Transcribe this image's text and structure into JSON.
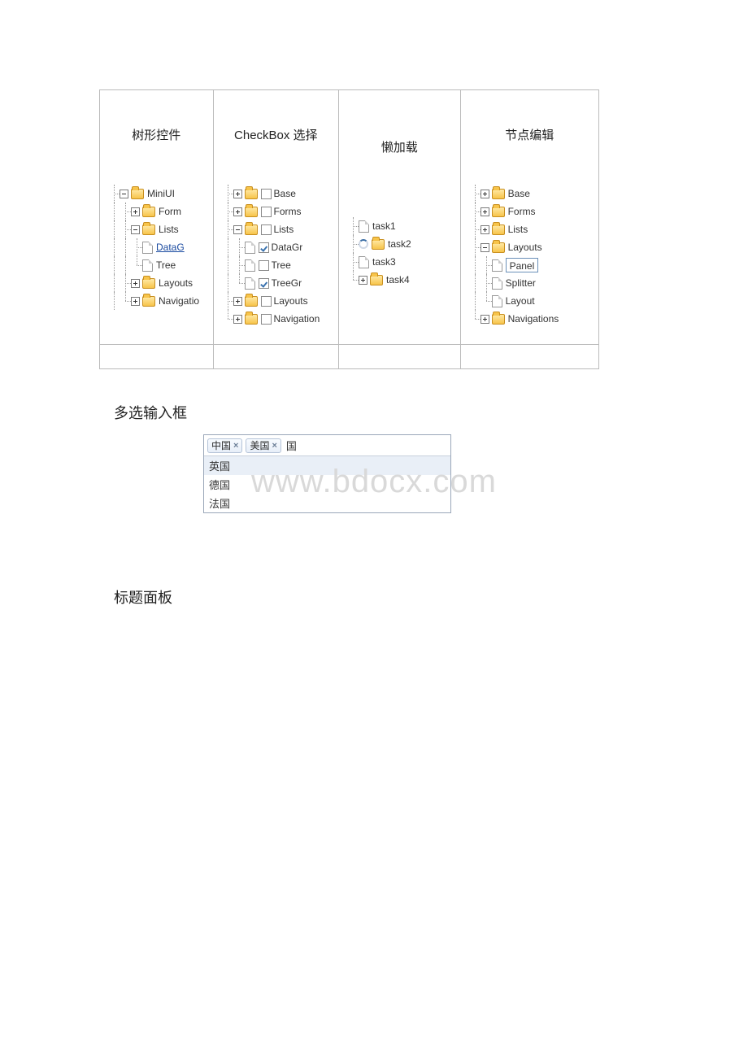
{
  "watermark": "www.bdocx.com",
  "columns": [
    {
      "title": "树形控件",
      "tree": [
        {
          "depth": 0,
          "toggle": "minus",
          "icon": "folder",
          "label": "MiniUI"
        },
        {
          "depth": 1,
          "toggle": "plus",
          "icon": "folder",
          "label": "Form"
        },
        {
          "depth": 1,
          "toggle": "minus",
          "icon": "folder",
          "label": "Lists"
        },
        {
          "depth": 2,
          "toggle": null,
          "icon": "file",
          "label": "DataG",
          "link": true
        },
        {
          "depth": 2,
          "toggle": null,
          "icon": "file",
          "label": "Tree",
          "last": true
        },
        {
          "depth": 1,
          "toggle": "plus",
          "icon": "folder",
          "label": "Layouts"
        },
        {
          "depth": 1,
          "toggle": "plus",
          "icon": "folder",
          "label": "Navigatio",
          "last": true
        }
      ]
    },
    {
      "title": "CheckBox 选择",
      "tree": [
        {
          "depth": 0,
          "toggle": "plus",
          "icon": "folder",
          "cb": "unchecked",
          "label": "Base"
        },
        {
          "depth": 0,
          "toggle": "plus",
          "icon": "folder",
          "cb": "unchecked",
          "label": "Forms"
        },
        {
          "depth": 0,
          "toggle": "minus",
          "icon": "folder",
          "cb": "unchecked",
          "label": "Lists"
        },
        {
          "depth": 1,
          "toggle": null,
          "icon": "file",
          "cb": "checked",
          "label": "DataGr"
        },
        {
          "depth": 1,
          "toggle": null,
          "icon": "file",
          "cb": "unchecked",
          "label": "Tree"
        },
        {
          "depth": 1,
          "toggle": null,
          "icon": "file",
          "cb": "checked",
          "label": "TreeGr",
          "last": true
        },
        {
          "depth": 0,
          "toggle": "plus",
          "icon": "folder",
          "cb": "unchecked",
          "label": "Layouts"
        },
        {
          "depth": 0,
          "toggle": "plus",
          "icon": "folder",
          "cb": "unchecked",
          "label": "Navigation",
          "last": true
        }
      ]
    },
    {
      "title": "懒加载",
      "tree": [
        {
          "depth": 0,
          "toggle": null,
          "icon": "file",
          "label": "task1"
        },
        {
          "depth": 0,
          "toggle": "spinner",
          "icon": "folder",
          "label": "task2"
        },
        {
          "depth": 0,
          "toggle": null,
          "icon": "file",
          "label": "task3"
        },
        {
          "depth": 0,
          "toggle": "plus",
          "icon": "folder",
          "label": "task4",
          "last": true
        }
      ]
    },
    {
      "title": "节点编辑",
      "tree": [
        {
          "depth": 0,
          "toggle": "plus",
          "icon": "folder",
          "label": "Base"
        },
        {
          "depth": 0,
          "toggle": "plus",
          "icon": "folder",
          "label": "Forms"
        },
        {
          "depth": 0,
          "toggle": "plus",
          "icon": "folder",
          "label": "Lists"
        },
        {
          "depth": 0,
          "toggle": "minus",
          "icon": "folder",
          "label": "Layouts"
        },
        {
          "depth": 1,
          "toggle": null,
          "icon": "file",
          "label": "Panel",
          "editing": true
        },
        {
          "depth": 1,
          "toggle": null,
          "icon": "file",
          "label": "Splitter"
        },
        {
          "depth": 1,
          "toggle": null,
          "icon": "file",
          "label": "Layout",
          "last": true
        },
        {
          "depth": 0,
          "toggle": "plus",
          "icon": "folder",
          "label": "Navigations",
          "last": true
        }
      ]
    }
  ],
  "multiselect_title": "多选输入框",
  "multiselect": {
    "tags": [
      "中国",
      "美国"
    ],
    "typed": "国",
    "options": [
      {
        "label": "英国",
        "hover": true
      },
      {
        "label": "德国",
        "hover": false
      },
      {
        "label": "法国",
        "hover": false
      }
    ]
  },
  "panel_title": "标题面板"
}
